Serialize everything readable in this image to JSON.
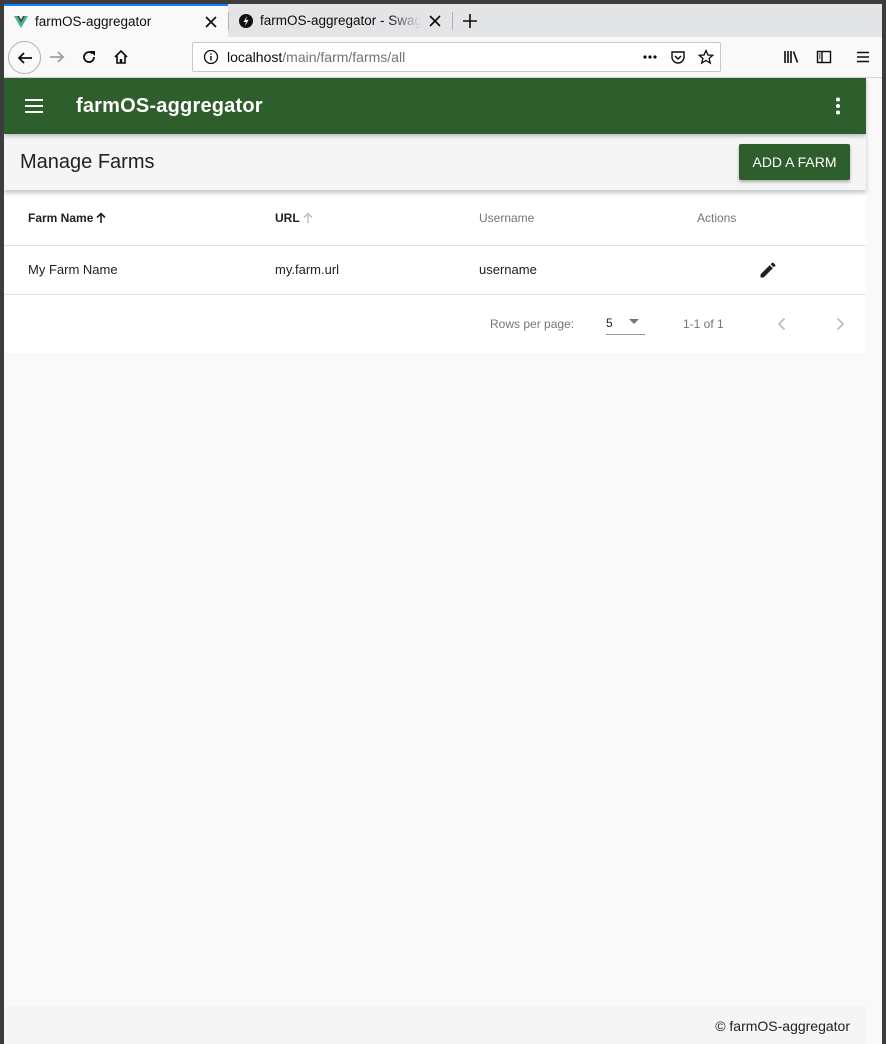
{
  "browser": {
    "tabs": [
      {
        "title": "farmOS-aggregator",
        "active": true,
        "favicon": "vue-logo-icon"
      },
      {
        "title": "farmOS-aggregator - Swagger UI",
        "active": false,
        "favicon": "swagger-icon"
      }
    ],
    "url": {
      "host": "localhost",
      "path": "/main/farm/farms/all"
    }
  },
  "app": {
    "title": "farmOS-aggregator",
    "theme_color": "#2e5e2b"
  },
  "page": {
    "title": "Manage Farms",
    "add_button_label": "ADD A FARM"
  },
  "table": {
    "headers": {
      "farm_name": "Farm Name",
      "url": "URL",
      "username": "Username",
      "actions": "Actions"
    },
    "sort_column": "farm_name",
    "rows": [
      {
        "farm_name": "My Farm Name",
        "url": "my.farm.url",
        "username": "username"
      }
    ],
    "footer": {
      "rows_per_page_label": "Rows per page:",
      "rows_per_page_value": "5",
      "range_text": "1-1 of 1"
    }
  },
  "footer": {
    "text": "© farmOS-aggregator"
  }
}
